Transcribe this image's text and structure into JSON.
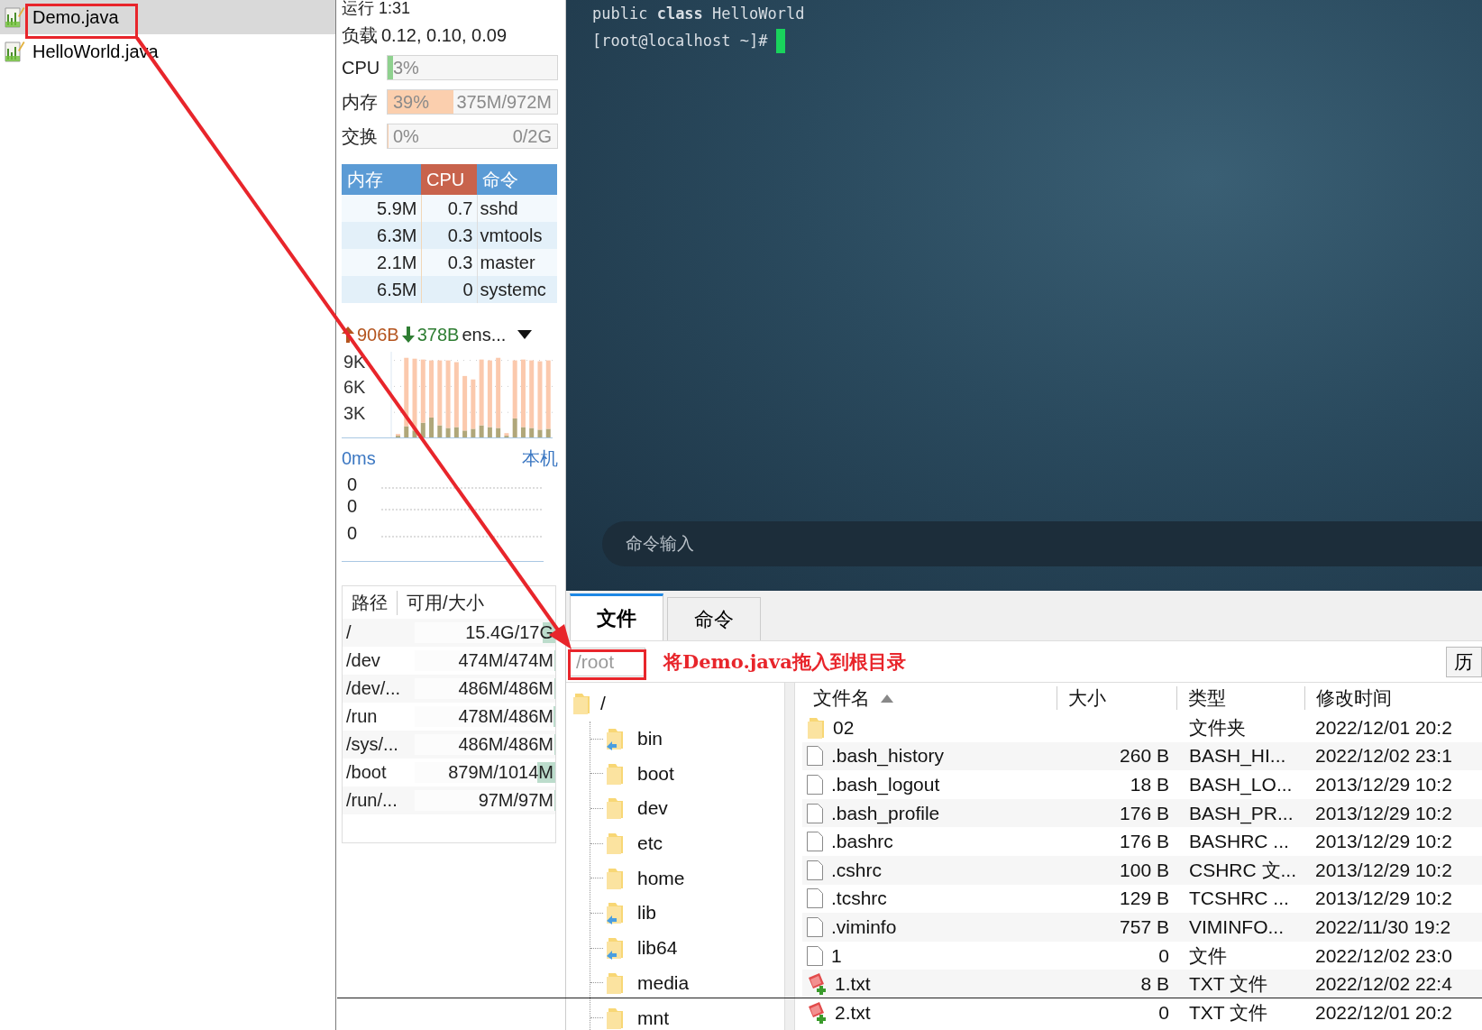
{
  "left_pane": {
    "files": [
      {
        "name": "Demo.java",
        "selected": true
      },
      {
        "name": "HelloWorld.java",
        "selected": false
      }
    ]
  },
  "monitor": {
    "uptime": "运行 1:31",
    "load": {
      "label": "负载",
      "value": "0.12, 0.10, 0.09"
    },
    "meters": [
      {
        "label": "CPU",
        "level": 0.03,
        "color": "#8fd18f",
        "reading": "3%"
      },
      {
        "label": "内存",
        "level": 0.39,
        "color": "#fbcfae",
        "reading": "39%",
        "detail": "375M/972M"
      },
      {
        "label": "交换",
        "level": 0,
        "color": "#fbcfae",
        "reading": "0%",
        "detail": "0/2G"
      }
    ],
    "processes": {
      "columns": [
        {
          "label": "内存",
          "selected": false
        },
        {
          "label": "CPU",
          "selected": true
        },
        {
          "label": "命令",
          "selected": false
        }
      ],
      "rows": [
        [
          "5.9M",
          "0.7",
          "sshd"
        ],
        [
          "6.3M",
          "0.3",
          "vmtools"
        ],
        [
          "2.1M",
          "0.3",
          "master"
        ],
        [
          "6.5M",
          "0",
          "systemc"
        ]
      ]
    },
    "network": {
      "up": "906B",
      "down": "378B",
      "interface": "ens...",
      "chart_data": {
        "type": "bar",
        "stacked": true,
        "grid": true,
        "ylim": [
          0,
          10000
        ],
        "yticks": [
          {
            "value": 3000,
            "label": "3K"
          },
          {
            "value": 6000,
            "label": "6K"
          },
          {
            "value": 9000,
            "label": "9K"
          }
        ],
        "series": [
          {
            "color": "#b0a77a",
            "values": [
              300,
              1400,
              900,
              1800,
              2400,
              1500,
              1200,
              1300,
              900,
              1100,
              1500,
              1300,
              1200,
              300,
              2300,
              1300,
              1200,
              1000,
              1100
            ]
          },
          {
            "color": "#fbc9ad",
            "values": [
              200,
              7900,
              8300,
              7300,
              6600,
              7500,
              7800,
              7500,
              6300,
              5700,
              7600,
              7700,
              8100,
              300,
              6700,
              7800,
              7800,
              7900,
              7900
            ]
          }
        ]
      }
    },
    "latency": {
      "ping": "0ms",
      "host": "本机",
      "labels": [
        "0",
        "0",
        "0"
      ]
    },
    "disks": {
      "columns": [
        "路径",
        "可用/大小"
      ],
      "rows": [
        {
          "path": "/",
          "size": "15.4G/17G",
          "level": 0.09
        },
        {
          "path": "/dev",
          "size": "474M/474M",
          "level": 0
        },
        {
          "path": "/dev/...",
          "size": "486M/486M",
          "level": 0
        },
        {
          "path": "/run",
          "size": "478M/486M",
          "level": 0.016
        },
        {
          "path": "/sys/...",
          "size": "486M/486M",
          "level": 0
        },
        {
          "path": "/boot",
          "size": "879M/1014M",
          "level": 0.13
        },
        {
          "path": "/run/...",
          "size": "97M/97M",
          "level": 0
        }
      ]
    }
  },
  "terminal": {
    "lines": [
      "public **class** HelloWorld",
      "[root@localhost ~]#"
    ],
    "command_input": {
      "placeholder": "命令输入"
    }
  },
  "file_manager": {
    "tabs": [
      {
        "label": "文件",
        "selected": true
      },
      {
        "label": "命令",
        "selected": false
      }
    ],
    "path": "/root",
    "annotation": "将Demo.java拖入到根目录",
    "history_button": "历",
    "tree": {
      "name": "/",
      "children": [
        {
          "name": "bin",
          "link": true
        },
        {
          "name": "boot",
          "link": false
        },
        {
          "name": "dev",
          "link": false
        },
        {
          "name": "etc",
          "link": false
        },
        {
          "name": "home",
          "link": false
        },
        {
          "name": "lib",
          "link": true
        },
        {
          "name": "lib64",
          "link": true
        },
        {
          "name": "media",
          "link": false
        },
        {
          "name": "mnt",
          "link": false
        }
      ]
    },
    "list": {
      "columns": [
        {
          "label": "文件名",
          "sorted": true
        },
        {
          "label": "大小",
          "sorted": false
        },
        {
          "label": "类型",
          "sorted": false
        },
        {
          "label": "修改时间",
          "sorted": false
        }
      ],
      "rows": [
        {
          "kind": "folder",
          "name": "02",
          "type": "文件夹",
          "modified": "2022/12/01 20:2"
        },
        {
          "kind": "file",
          "name": ".bash_history",
          "size": "260 B",
          "type": "BASH_HI...",
          "modified": "2022/12/02 23:1"
        },
        {
          "kind": "file",
          "name": ".bash_logout",
          "size": "18 B",
          "type": "BASH_LO...",
          "modified": "2013/12/29 10:2"
        },
        {
          "kind": "file",
          "name": ".bash_profile",
          "size": "176 B",
          "type": "BASH_PR...",
          "modified": "2013/12/29 10:2"
        },
        {
          "kind": "file",
          "name": ".bashrc",
          "size": "176 B",
          "type": "BASHRC ...",
          "modified": "2013/12/29 10:2"
        },
        {
          "kind": "file",
          "name": ".cshrc",
          "size": "100 B",
          "type": "CSHRC 文...",
          "modified": "2013/12/29 10:2"
        },
        {
          "kind": "file",
          "name": ".tcshrc",
          "size": "129 B",
          "type": "TCSHRC ...",
          "modified": "2013/12/29 10:2"
        },
        {
          "kind": "file",
          "name": ".viminfo",
          "size": "757 B",
          "type": "VIMINFO...",
          "modified": "2022/11/30 19:2"
        },
        {
          "kind": "file",
          "name": "1",
          "size": "0",
          "type": "文件",
          "modified": "2022/12/02 23:0"
        },
        {
          "kind": "text",
          "name": "1.txt",
          "size": "8 B",
          "type": "TXT 文件",
          "modified": "2022/12/02 22:4"
        },
        {
          "kind": "text",
          "name": "2.txt",
          "size": "0",
          "type": "TXT 文件",
          "modified": "2022/12/01 20:2"
        }
      ]
    }
  }
}
